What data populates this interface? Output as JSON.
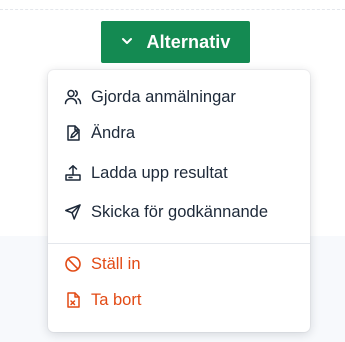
{
  "button": {
    "label": "Alternativ",
    "icon": "chevron-down-icon",
    "color": "#148a52"
  },
  "menu": {
    "items": [
      {
        "label": "Gjorda anmälningar",
        "icon": "users-icon",
        "danger": false
      },
      {
        "label": "Ändra",
        "icon": "edit-document-icon",
        "danger": false
      },
      {
        "label": "Ladda upp resultat",
        "icon": "upload-icon",
        "danger": false
      },
      {
        "label": "Skicka för godkännande",
        "icon": "send-icon",
        "danger": false
      },
      {
        "label": "Ställ in",
        "icon": "cancel-icon",
        "danger": true
      },
      {
        "label": "Ta bort",
        "icon": "delete-file-icon",
        "danger": true
      }
    ],
    "danger_color": "#e24a14"
  }
}
